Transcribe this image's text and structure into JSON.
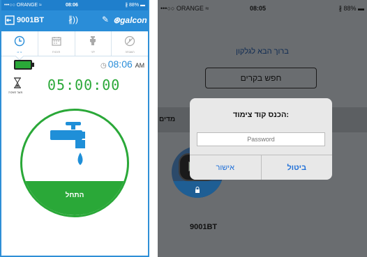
{
  "left": {
    "status": {
      "carrier": "•••○○ ORANGE ≈",
      "time": "08:06",
      "battery": "∦ 88% ▬"
    },
    "header": {
      "device": "9001BT",
      "logo": "galcon"
    },
    "tabs": [
      {
        "icon": "clock-icon",
        "label": "•••••"
      },
      {
        "icon": "calendar-icon",
        "label": "תוכנית"
      },
      {
        "icon": "faucet-icon",
        "label": "ידני"
      },
      {
        "icon": "rain-off-icon",
        "label": "השבתה"
      }
    ],
    "clock": {
      "time": "08:06",
      "ampm": "AM"
    },
    "timer": {
      "value": "05:00:00",
      "label": "משך השקיה"
    },
    "start_label": "התחל",
    "colors": {
      "accent": "#2a8dd8",
      "green": "#2aa838"
    }
  },
  "right": {
    "status": {
      "carrier": "•••○○ ORANGE ≈",
      "time": "08:05",
      "battery": "∦ 88% ▬"
    },
    "welcome": "ברוך הבא לגלקון",
    "search_label": "חפש בקרים",
    "devices_label": "מדים",
    "device_name": "9001BT",
    "dialog": {
      "title": "הכנס קוד צימוד:",
      "placeholder": "Password",
      "ok_label": "אישור",
      "cancel_label": "ביטול"
    }
  }
}
